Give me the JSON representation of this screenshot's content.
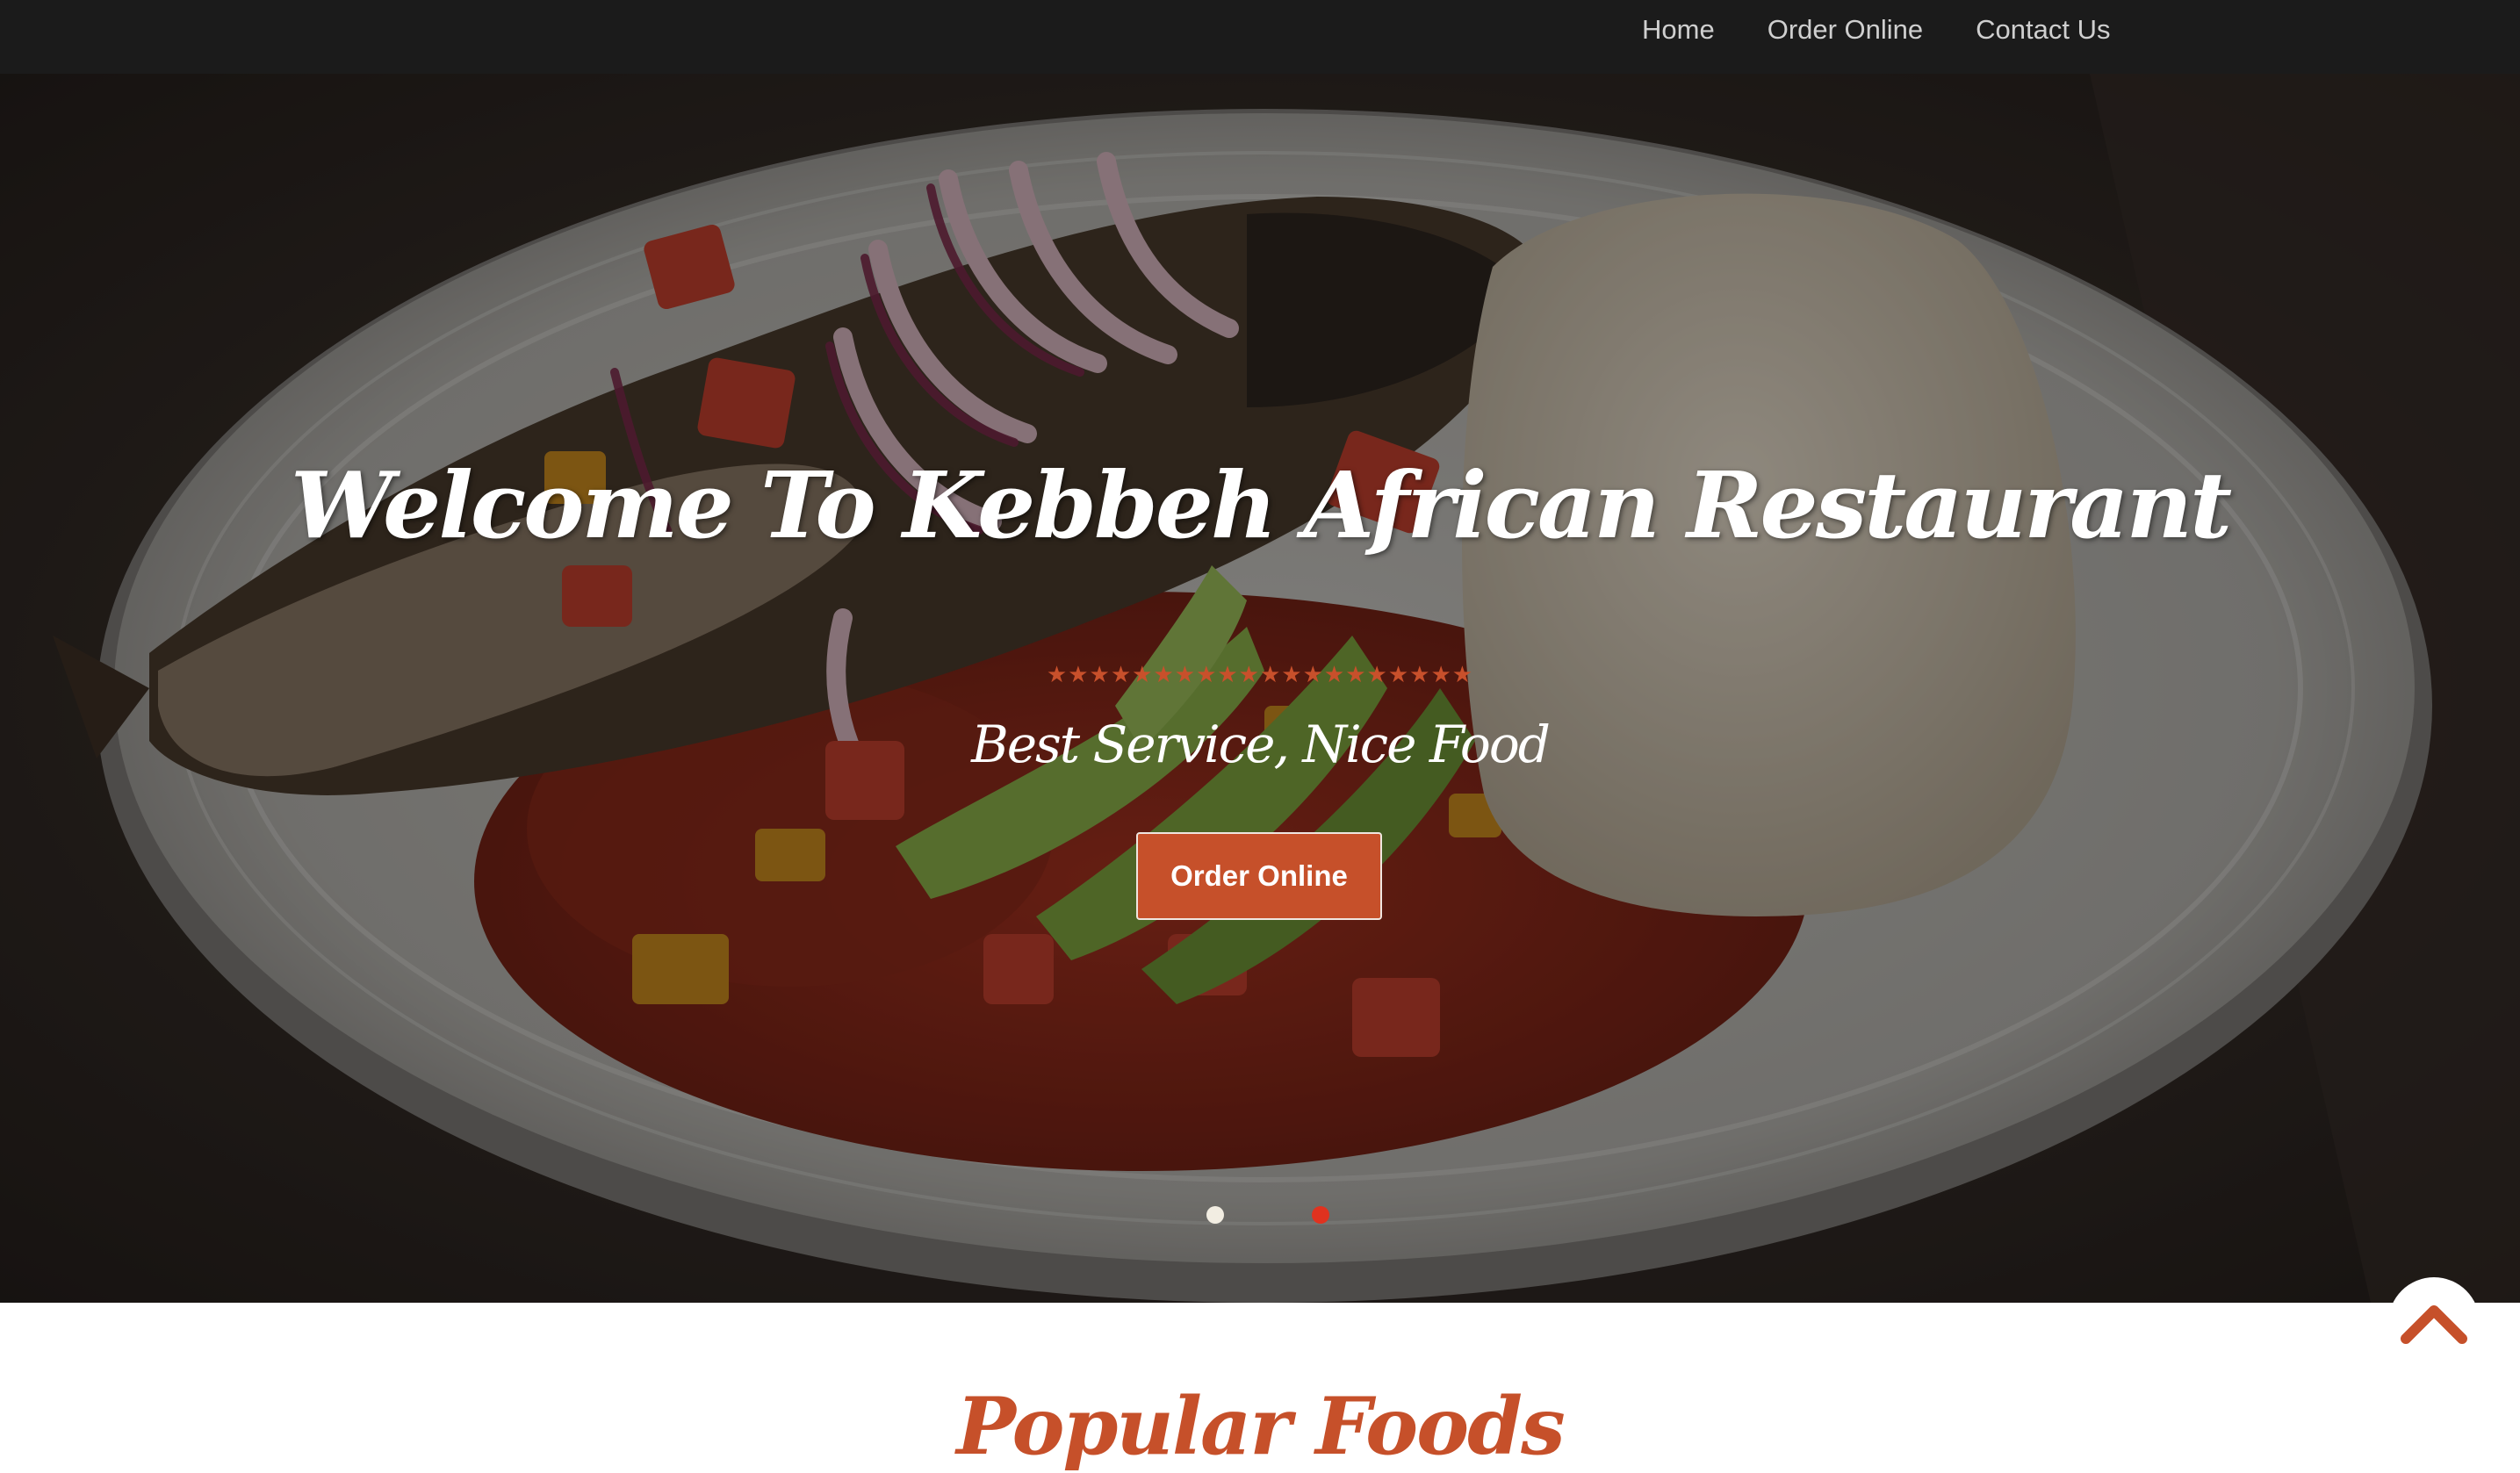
{
  "nav": {
    "items": [
      {
        "label": "Home"
      },
      {
        "label": "Order Online"
      },
      {
        "label": "Contact Us"
      }
    ]
  },
  "hero": {
    "title": "Welcome To Kebbeh African Restaurant",
    "stars": "★★★★★★★★★★★★★★★★★★★★",
    "subtitle": "Best Service, Nice Food",
    "cta_label": "Order Online",
    "slides": {
      "count": 2,
      "active_index": 1
    },
    "image_icon": "food-plate-photo"
  },
  "scroll_top": {
    "icon": "chevron-up-icon"
  },
  "section": {
    "heading": "Popular Foods"
  },
  "colors": {
    "accent": "#c6502a",
    "nav_bg": "#1b1b1b",
    "active_dot": "#e0321f",
    "inactive_dot": "#f2ede2"
  }
}
